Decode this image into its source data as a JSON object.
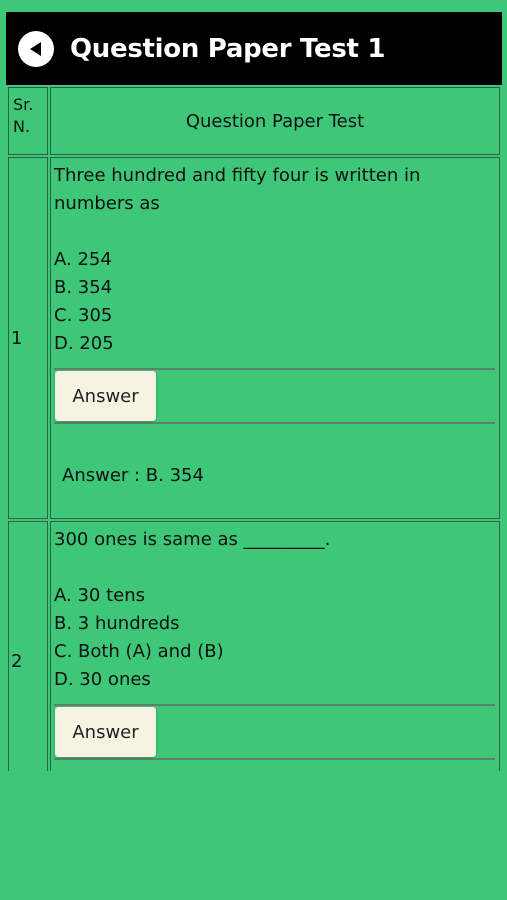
{
  "header": {
    "title": "Question Paper Test 1",
    "back_icon": "back-arrow-icon"
  },
  "table": {
    "col_sr": "Sr. N.",
    "col_sr_line1": "Sr.",
    "col_sr_line2": "N.",
    "col_question": "Question Paper Test"
  },
  "questions": [
    {
      "num": "1",
      "text": "Three hundred and fifty four is written in numbers as",
      "options": [
        "A. 254",
        "B. 354",
        "C. 305",
        "D. 205"
      ],
      "answer_button": "Answer",
      "answer_text": "Answer : B. 354"
    },
    {
      "num": "2",
      "text": "300 ones is same as _________.",
      "options": [
        "A. 30 tens",
        "B. 3 hundreds",
        "C. Both (A) and (B)",
        "D. 30 ones"
      ],
      "answer_button": "Answer"
    }
  ]
}
